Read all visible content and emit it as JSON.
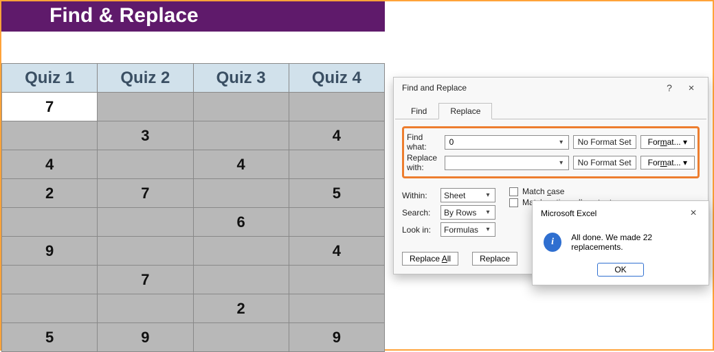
{
  "banner": "Find & Replace",
  "table": {
    "headers": [
      "Quiz 1",
      "Quiz 2",
      "Quiz 3",
      "Quiz 4"
    ],
    "rows": [
      [
        "7",
        "",
        "",
        ""
      ],
      [
        "",
        "3",
        "",
        "4"
      ],
      [
        "4",
        "",
        "4",
        ""
      ],
      [
        "2",
        "7",
        "",
        "5"
      ],
      [
        "",
        "",
        "6",
        ""
      ],
      [
        "9",
        "",
        "",
        "4"
      ],
      [
        "",
        "7",
        "",
        ""
      ],
      [
        "",
        "",
        "2",
        ""
      ],
      [
        "5",
        "9",
        "",
        "9"
      ]
    ],
    "active_cell": [
      0,
      0
    ]
  },
  "dialog": {
    "title": "Find and Replace",
    "help": "?",
    "close": "×",
    "tabs": {
      "find": "Find",
      "replace": "Replace",
      "active": "replace"
    },
    "find_what_label": "Find what:",
    "find_what_value": "0",
    "replace_with_label": "Replace with:",
    "replace_with_value": "",
    "no_format": "No Format Set",
    "format_btn": "Format...",
    "within_label": "Within:",
    "within_value": "Sheet",
    "search_label": "Search:",
    "search_value": "By Rows",
    "lookin_label": "Look in:",
    "lookin_value": "Formulas",
    "match_case": "Match case",
    "match_entire": "Match entire cell contents",
    "replace_all": "Replace All",
    "replace": "Replace"
  },
  "alert": {
    "title": "Microsoft Excel",
    "close": "×",
    "message": "All done. We made 22 replacements.",
    "ok": "OK"
  },
  "chart_data": {
    "type": "table",
    "headers": [
      "Quiz 1",
      "Quiz 2",
      "Quiz 3",
      "Quiz 4"
    ],
    "rows": [
      [
        7,
        null,
        null,
        null
      ],
      [
        null,
        3,
        null,
        4
      ],
      [
        4,
        null,
        4,
        null
      ],
      [
        2,
        7,
        null,
        5
      ],
      [
        null,
        null,
        6,
        null
      ],
      [
        9,
        null,
        null,
        4
      ],
      [
        null,
        7,
        null,
        null
      ],
      [
        null,
        null,
        2,
        null
      ],
      [
        5,
        9,
        null,
        9
      ]
    ]
  }
}
